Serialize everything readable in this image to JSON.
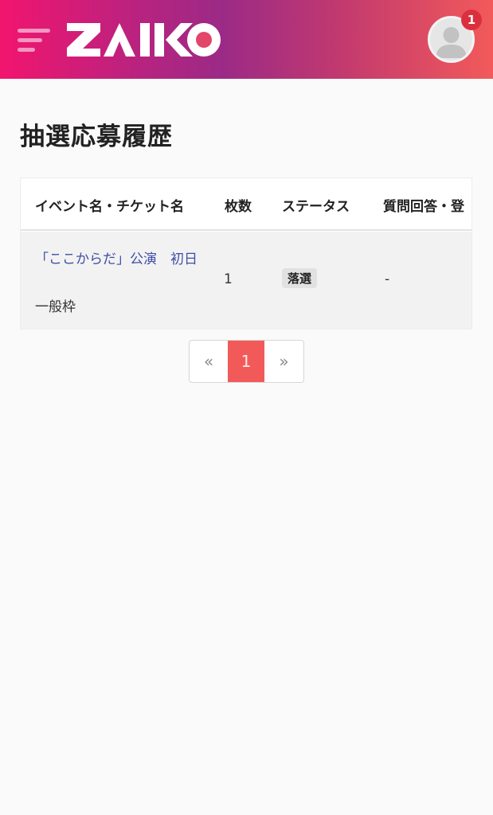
{
  "header": {
    "logo_text": "ZAIKO",
    "notification_count": "1"
  },
  "page": {
    "title": "抽選応募履歴"
  },
  "table": {
    "columns": [
      "イベント名・チケット名",
      "枚数",
      "ステータス",
      "質問回答・登"
    ],
    "rows": [
      {
        "event_name": "「ここからだ」公演　初日",
        "ticket_name": "一般枠",
        "quantity": "1",
        "status": "落選",
        "answer": "-"
      }
    ]
  },
  "pagination": {
    "prev": "«",
    "current": "1",
    "next": "»"
  },
  "colors": {
    "accent": "#f25a5a",
    "link": "#3f4fa7",
    "badge": "#dc2f3e"
  }
}
